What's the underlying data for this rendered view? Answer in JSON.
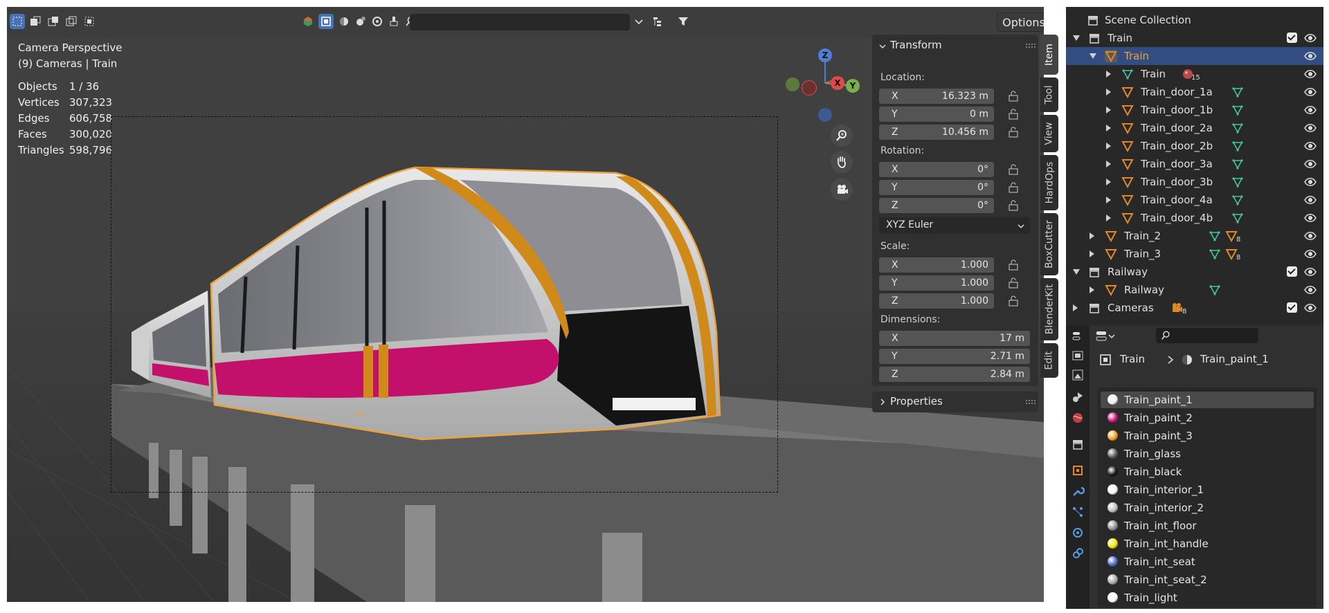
{
  "viewport": {
    "view_name": "Camera Perspective",
    "view_subtitle": "(9) Cameras | Train",
    "options_label": "Options",
    "stats": [
      {
        "label": "Objects",
        "value": "1 / 36"
      },
      {
        "label": "Vertices",
        "value": "307,323"
      },
      {
        "label": "Edges",
        "value": "606,758"
      },
      {
        "label": "Faces",
        "value": "300,020"
      },
      {
        "label": "Triangles",
        "value": "598,796"
      }
    ],
    "gizmo": {
      "z": "Z",
      "x": "X",
      "y": "Y"
    },
    "colors": {
      "body_paint": "#c2106b",
      "accent_orange": "#d08a1a",
      "selection": "#f0a23a"
    }
  },
  "npanel": {
    "transform_title": "Transform",
    "location_label": "Location:",
    "location": [
      {
        "axis": "X",
        "value": "16.323 m"
      },
      {
        "axis": "Y",
        "value": "0 m"
      },
      {
        "axis": "Z",
        "value": "10.456 m"
      }
    ],
    "rotation_label": "Rotation:",
    "rotation": [
      {
        "axis": "X",
        "value": "0°"
      },
      {
        "axis": "Y",
        "value": "0°"
      },
      {
        "axis": "Z",
        "value": "0°"
      }
    ],
    "rotation_mode": "XYZ Euler",
    "scale_label": "Scale:",
    "scale": [
      {
        "axis": "X",
        "value": "1.000"
      },
      {
        "axis": "Y",
        "value": "1.000"
      },
      {
        "axis": "Z",
        "value": "1.000"
      }
    ],
    "dimensions_label": "Dimensions:",
    "dimensions": [
      {
        "axis": "X",
        "value": "17 m"
      },
      {
        "axis": "Y",
        "value": "2.71 m"
      },
      {
        "axis": "Z",
        "value": "2.84 m"
      }
    ],
    "properties_title": "Properties",
    "tabs": [
      "Item",
      "Tool",
      "View",
      "HardOps",
      "BoxCutter",
      "BlenderKit",
      "Edit"
    ]
  },
  "outliner": {
    "root": "Scene Collection",
    "rows": [
      {
        "label": "Train",
        "kind": "collection"
      },
      {
        "label": "Train",
        "kind": "object",
        "selected": true
      },
      {
        "label": "Train",
        "kind": "mesh",
        "badge": "15"
      },
      {
        "label": "Train_door_1a",
        "kind": "object"
      },
      {
        "label": "Train_door_1b",
        "kind": "object"
      },
      {
        "label": "Train_door_2a",
        "kind": "object"
      },
      {
        "label": "Train_door_2b",
        "kind": "object"
      },
      {
        "label": "Train_door_3a",
        "kind": "object"
      },
      {
        "label": "Train_door_3b",
        "kind": "object"
      },
      {
        "label": "Train_door_4a",
        "kind": "object"
      },
      {
        "label": "Train_door_4b",
        "kind": "object"
      },
      {
        "label": "Train_2",
        "kind": "object",
        "badge": "8"
      },
      {
        "label": "Train_3",
        "kind": "object",
        "badge": "8"
      },
      {
        "label": "Railway",
        "kind": "collection"
      },
      {
        "label": "Railway",
        "kind": "object"
      },
      {
        "label": "Cameras",
        "kind": "collection",
        "badge": "8"
      }
    ]
  },
  "properties": {
    "breadcrumb_object": "Train",
    "breadcrumb_material": "Train_paint_1",
    "materials": [
      {
        "name": "Train_paint_1",
        "color": "#f2f2f2",
        "selected": true
      },
      {
        "name": "Train_paint_2",
        "color": "#d0117a"
      },
      {
        "name": "Train_paint_3",
        "color": "#f0a21a"
      },
      {
        "name": "Train_glass",
        "color": "#5a5a5a"
      },
      {
        "name": "Train_black",
        "color": "#111111"
      },
      {
        "name": "Train_interior_1",
        "color": "#f5f5f5"
      },
      {
        "name": "Train_interior_2",
        "color": "#bdbdbd"
      },
      {
        "name": "Train_int_floor",
        "color": "#8e8e8e"
      },
      {
        "name": "Train_int_handle",
        "color": "#f3e600"
      },
      {
        "name": "Train_int_seat",
        "color": "#4c64c8"
      },
      {
        "name": "Train_int_seat_2",
        "color": "#a8a8a8"
      },
      {
        "name": "Train_light",
        "color": "#ffffff"
      }
    ]
  }
}
